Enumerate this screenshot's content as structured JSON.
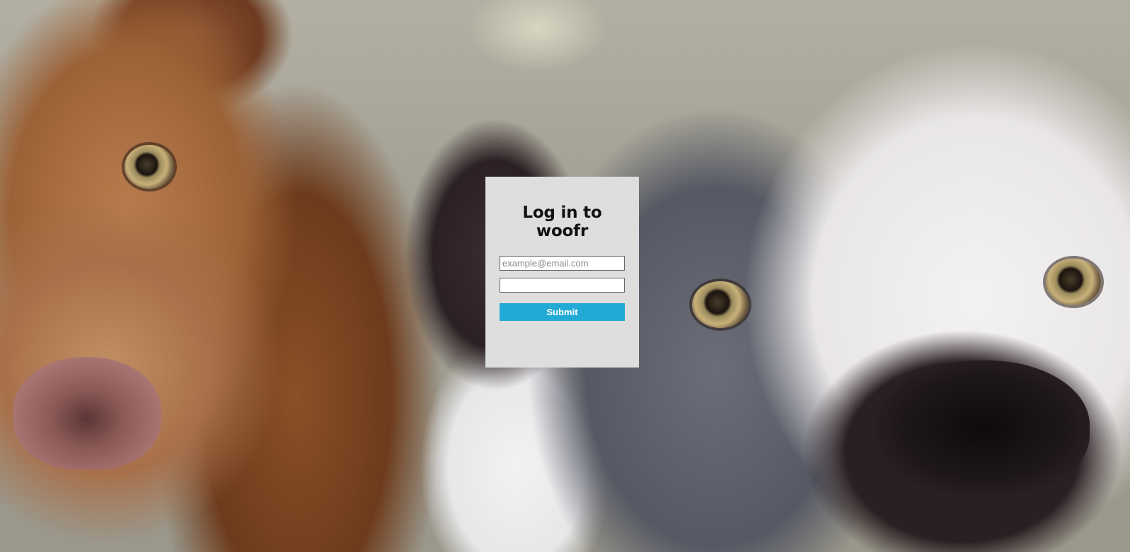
{
  "login_card": {
    "title": "Log in to woofr",
    "email_placeholder": "example@email.com",
    "email_value": "",
    "password_value": "",
    "submit_label": "Submit"
  },
  "colors": {
    "card_background": "#dedede",
    "submit_background": "#22aad6",
    "submit_text": "#ffffff"
  }
}
